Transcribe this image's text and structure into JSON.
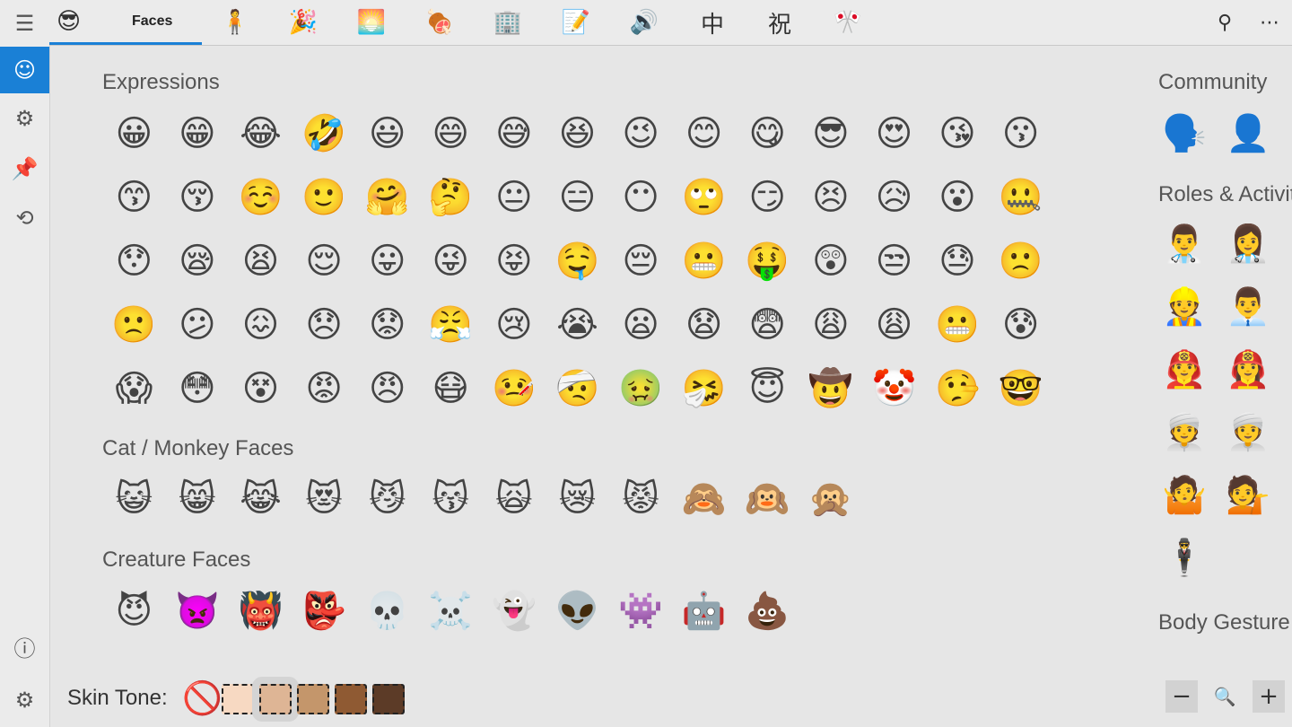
{
  "rail": {
    "menu_icon": "☰",
    "items": [
      {
        "name": "smiley",
        "glyph": "☺"
      },
      {
        "name": "symbols",
        "glyph": "⚙"
      },
      {
        "name": "pin",
        "glyph": "📌"
      },
      {
        "name": "history",
        "glyph": "⟲"
      }
    ],
    "info_icon": "ⓘ",
    "settings_icon": "⚙"
  },
  "topbar": {
    "selected_tab_label": "Faces",
    "tabs": [
      "😎",
      "🧍",
      "🎉",
      "🌅",
      "🍖",
      "🏢",
      "📝",
      "🔊",
      "中",
      "祝",
      "🎌"
    ],
    "search_icon": "⚲",
    "more_icon": "⋯"
  },
  "sections": {
    "expressions_title": "Expressions",
    "expressions": [
      "😀",
      "😁",
      "😂",
      "🤣",
      "😃",
      "😄",
      "😅",
      "😆",
      "😉",
      "😊",
      "😋",
      "😎",
      "😍",
      "😘",
      "😗",
      "😙",
      "😚",
      "☺️",
      "🙂",
      "🤗",
      "🤔",
      "😐",
      "😑",
      "😶",
      "🙄",
      "😏",
      "😣",
      "😥",
      "😮",
      "🤐",
      "😯",
      "😪",
      "😫",
      "😌",
      "😛",
      "😜",
      "😝",
      "🤤",
      "😔",
      "😬",
      "🤑",
      "😲",
      "😒",
      "😓",
      "🙁",
      "🙁",
      "😕",
      "😖",
      "😞",
      "😟",
      "😤",
      "😢",
      "😭",
      "😦",
      "😧",
      "😨",
      "😩",
      "😩",
      "😬",
      "😰",
      "😱",
      "😳",
      "😵",
      "😡",
      "😠",
      "😷",
      "🤒",
      "🤕",
      "🤢",
      "🤧",
      "😇",
      "🤠",
      "🤡",
      "🤥",
      "🤓"
    ],
    "cats_title": "Cat / Monkey Faces",
    "cats": [
      "😺",
      "😸",
      "😹",
      "😻",
      "😼",
      "😽",
      "🙀",
      "😿",
      "😾",
      "🙈",
      "🙉",
      "🙊"
    ],
    "creatures_title": "Creature Faces",
    "creatures": [
      "😈",
      "👿",
      "👹",
      "👺",
      "💀",
      "☠️",
      "👻",
      "👽",
      "👾",
      "🤖",
      "💩"
    ]
  },
  "people": {
    "community_title": "Community",
    "community": [
      "🗣️",
      "👤"
    ],
    "roles_title": "Roles & Activities",
    "roles": [
      [
        "👨‍⚕️",
        "👩‍⚕️"
      ],
      [
        "👷",
        "👨‍💼"
      ],
      [
        "👨‍🚒",
        "👩‍🚒"
      ],
      [
        "👳",
        "👳‍♀️"
      ],
      [
        "🤷",
        "💁"
      ],
      [
        "🕴️"
      ]
    ],
    "body_gesture_title": "Body Gesture"
  },
  "bottom": {
    "skin_tone_label": "Skin Tone:",
    "no_tone_icon": "🚫",
    "swatches": [
      "#f7d9c2",
      "#deb595",
      "#c4966b",
      "#8f5a33",
      "#5c3b27"
    ],
    "selected_swatch_index": 1,
    "zoom_out_icon": "−",
    "zoom_search_icon": "🔍",
    "zoom_in_icon": "+"
  }
}
